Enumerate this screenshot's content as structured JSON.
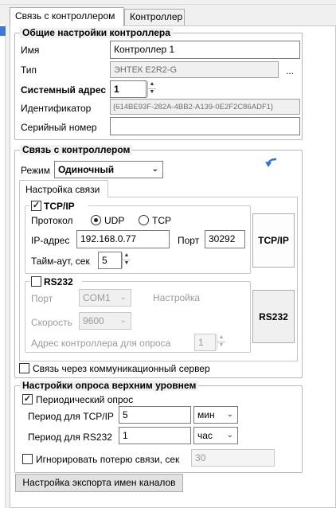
{
  "tabs": [
    {
      "label": "Связь с контроллером",
      "active": true
    },
    {
      "label": "Контроллер",
      "active": false
    }
  ],
  "general": {
    "title": "Общие настройки контроллера",
    "name_label": "Имя",
    "name_value": "Контроллер 1",
    "type_label": "Тип",
    "type_value": "ЭНТЕК E2R2-G",
    "type_button": "...",
    "sysaddr_label": "Системный адрес",
    "sysaddr_value": "1",
    "id_label": "Идентификатор",
    "id_value": "{614BE93F-282A-4BB2-A139-0E2F2C86ADF1}",
    "serial_label": "Серийный номер",
    "serial_value": ""
  },
  "connection": {
    "title": "Связь с контроллером",
    "mode_label": "Режим",
    "mode_value": "Одиночный",
    "subtab_label": "Настройка связи",
    "tcp": {
      "title": "TCP/IP",
      "checked": true,
      "protocol_label": "Протокол",
      "udp_label": "UDP",
      "tcp_label": "TCP",
      "selected": "UDP",
      "ip_label": "IP-адрес",
      "ip_value": "192.168.0.77",
      "port_label": "Порт",
      "port_value": "30292",
      "timeout_label": "Тайм-аут, сек",
      "timeout_value": "5"
    },
    "rs232": {
      "title": "RS232",
      "checked": false,
      "port_label": "Порт",
      "port_value": "COM1",
      "settings_label": "Настройка",
      "speed_label": "Скорость",
      "speed_value": "9600",
      "addr_label": "Адрес контроллера для опроса",
      "addr_value": "1"
    },
    "tcp_button": "TCP/IP",
    "rs232_button": "RS232",
    "comm_server_label": "Связь через коммуникационный сервер",
    "comm_server_checked": false
  },
  "polling": {
    "title": "Настройки опроса верхним уровнем",
    "periodic_label": "Периодический опрос",
    "periodic_checked": true,
    "tcp_period_label": "Период для TCP/IP",
    "tcp_period_value": "5",
    "tcp_period_unit": "мин",
    "rs_period_label": "Период для RS232",
    "rs_period_value": "1",
    "rs_period_unit": "час",
    "ignore_label": "Игнорировать потерю связи, сек",
    "ignore_checked": false,
    "ignore_value": "30"
  },
  "export_button": "Настройка экспорта имен каналов",
  "colors": {
    "selection": "#3b78d8",
    "link_arrow": "#2f6fd6"
  },
  "icons": {
    "mode_arrow": "blue-curved-arrow-icon",
    "dropdown": "chevron-down-icon"
  }
}
